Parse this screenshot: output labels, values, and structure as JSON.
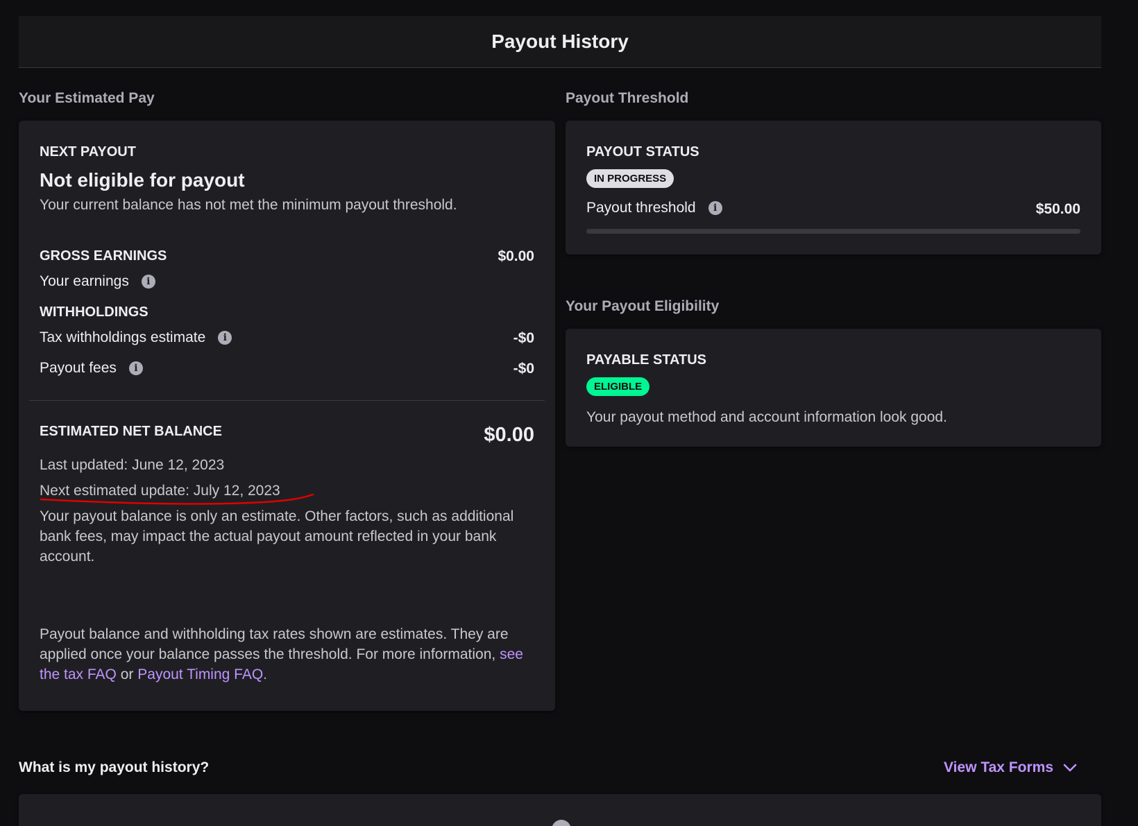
{
  "header": {
    "title": "Payout History"
  },
  "left": {
    "section_title": "Your Estimated Pay",
    "next_payout_label": "NEXT PAYOUT",
    "next_payout_status": "Not eligible for payout",
    "next_payout_desc": "Your current balance has not met the minimum payout threshold.",
    "gross_label": "GROSS EARNINGS",
    "gross_value": "$0.00",
    "earnings_label": "Your earnings",
    "withholdings_label": "WITHHOLDINGS",
    "tax_label": "Tax withholdings estimate",
    "tax_value": "-$0",
    "fees_label": "Payout fees",
    "fees_value": "-$0",
    "net_label": "ESTIMATED NET BALANCE",
    "net_value": "$0.00",
    "last_updated": "Last updated: June 12, 2023",
    "next_update": "Next estimated update: July 12, 2023",
    "estimate_note": "Your payout balance is only an estimate. Other factors, such as additional bank fees, may impact the actual payout amount reflected in your bank account.",
    "footer_text": "Payout balance and withholding tax rates shown are estimates. They are applied once your balance passes the threshold. For more information,",
    "footer_link_tax": "see the tax FAQ",
    "footer_or": "or",
    "footer_link_timing": "Payout Timing FAQ."
  },
  "threshold": {
    "section_title": "Payout Threshold",
    "status_label": "PAYOUT STATUS",
    "status_badge": "IN PROGRESS",
    "threshold_label": "Payout threshold",
    "threshold_value": "$50.00",
    "progress_fraction": 0
  },
  "eligibility": {
    "section_title": "Your Payout Eligibility",
    "status_label": "PAYABLE STATUS",
    "status_badge": "ELIGIBLE",
    "desc": "Your payout method and account information look good."
  },
  "history": {
    "title": "What is my payout history?",
    "view_tax_forms": "View Tax Forms"
  },
  "colors": {
    "background": "#0e0e10",
    "card": "#1f1f23",
    "accent": "#bf94ff",
    "eligible": "#00f593",
    "annotation": "#e00000"
  }
}
